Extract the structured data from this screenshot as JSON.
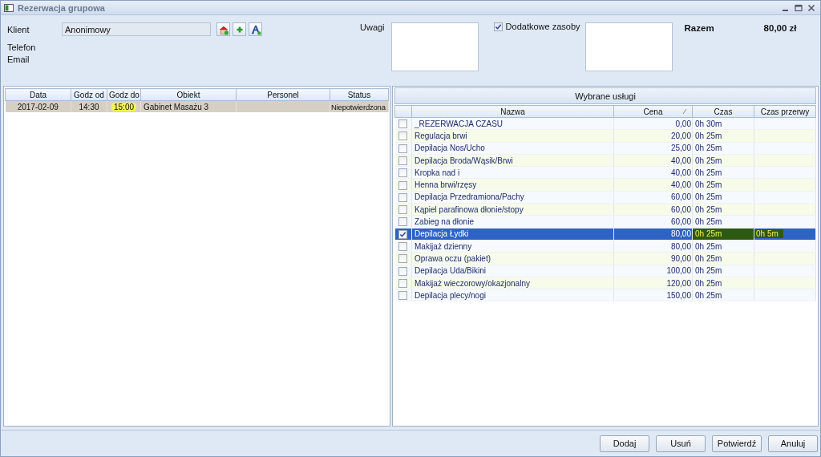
{
  "window": {
    "title": "Rezerwacja grupowa"
  },
  "client": {
    "label": "Klient",
    "value": "Anonimowy",
    "phone_label": "Telefon",
    "email_label": "Email"
  },
  "notes": {
    "label": "Uwagi"
  },
  "extra_resources": {
    "label": "Dodatkowe zasoby",
    "checked": true
  },
  "total": {
    "label": "Razem",
    "value": "80,00 zł"
  },
  "reservations": {
    "columns": [
      "Data",
      "Godz od",
      "Godz do",
      "Obiekt",
      "Personel",
      "Status"
    ],
    "rows": [
      {
        "selected": true,
        "cells": [
          {
            "text": "2017-02-09",
            "highlighted": false
          },
          {
            "text": "14:30",
            "highlighted": false
          },
          {
            "text": "15:00",
            "highlighted": true
          },
          {
            "text": "Gabinet Masażu 3",
            "highlighted": false
          },
          {
            "text": "",
            "highlighted": false
          },
          {
            "text": "Niepotwierdzona",
            "highlighted": false
          }
        ]
      }
    ]
  },
  "services": {
    "title": "Wybrane usługi",
    "columns": [
      "Nazwa",
      "Cena",
      "Czas",
      "Czas przerwy"
    ],
    "rows": [
      {
        "checked": false,
        "selected": false,
        "highlighted": false,
        "name": "_REZERWACJA CZASU",
        "price": "0,00",
        "time": "0h 30m",
        "break": ""
      },
      {
        "checked": false,
        "selected": false,
        "highlighted": false,
        "name": "Regulacja brwi",
        "price": "20,00",
        "time": "0h 25m",
        "break": ""
      },
      {
        "checked": false,
        "selected": false,
        "highlighted": false,
        "name": "Depilacja Nos/Ucho",
        "price": "25,00",
        "time": "0h 25m",
        "break": ""
      },
      {
        "checked": false,
        "selected": false,
        "highlighted": false,
        "name": "Depilacja Broda/Wąsik/Brwi",
        "price": "40,00",
        "time": "0h 25m",
        "break": ""
      },
      {
        "checked": false,
        "selected": false,
        "highlighted": false,
        "name": "Kropka nad i",
        "price": "40,00",
        "time": "0h 25m",
        "break": ""
      },
      {
        "checked": false,
        "selected": false,
        "highlighted": false,
        "name": "Henna brwi/rzęsy",
        "price": "40,00",
        "time": "0h 25m",
        "break": ""
      },
      {
        "checked": false,
        "selected": false,
        "highlighted": false,
        "name": "Depilacja Przedramiona/Pachy",
        "price": "60,00",
        "time": "0h 25m",
        "break": ""
      },
      {
        "checked": false,
        "selected": false,
        "highlighted": false,
        "name": "Kąpiel parafinowa dłonie/stopy",
        "price": "60,00",
        "time": "0h 25m",
        "break": ""
      },
      {
        "checked": false,
        "selected": false,
        "highlighted": false,
        "name": "Zabieg na dłonie",
        "price": "60,00",
        "time": "0h 25m",
        "break": ""
      },
      {
        "checked": true,
        "selected": true,
        "highlighted": true,
        "name": "Depilacja Łydki",
        "price": "80,00",
        "time": "0h 25m",
        "break": "0h 5m"
      },
      {
        "checked": false,
        "selected": false,
        "highlighted": false,
        "name": "Makijaż dzienny",
        "price": "80,00",
        "time": "0h 25m",
        "break": ""
      },
      {
        "checked": false,
        "selected": false,
        "highlighted": false,
        "name": "Oprawa oczu (pakiet)",
        "price": "90,00",
        "time": "0h 25m",
        "break": ""
      },
      {
        "checked": false,
        "selected": false,
        "highlighted": false,
        "name": "Depilacja Uda/Bikini",
        "price": "100,00",
        "time": "0h 25m",
        "break": ""
      },
      {
        "checked": false,
        "selected": false,
        "highlighted": false,
        "name": "Makijaż wieczorowy/okazjonalny",
        "price": "120,00",
        "time": "0h 25m",
        "break": ""
      },
      {
        "checked": false,
        "selected": false,
        "highlighted": false,
        "name": "Depilacja plecy/nogi",
        "price": "150,00",
        "time": "0h 25m",
        "break": ""
      }
    ]
  },
  "buttons": [
    "Dodaj",
    "Usuń",
    "Potwierdź",
    "Anuluj"
  ]
}
